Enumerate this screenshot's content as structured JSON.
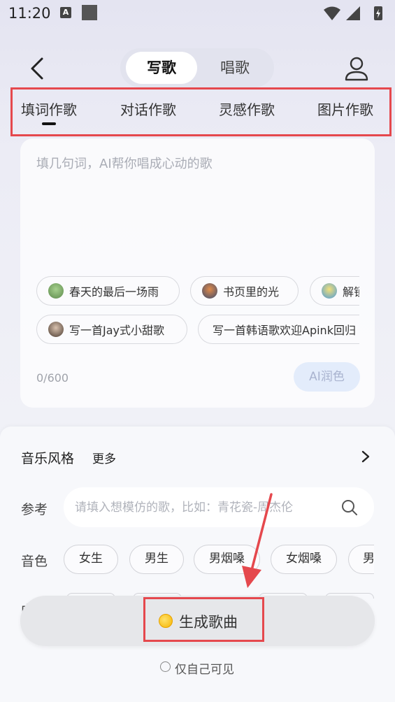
{
  "status_bar": {
    "time": "11:20",
    "app_icon_letter": "A"
  },
  "header": {
    "tabs": [
      {
        "label": "写歌",
        "active": true
      },
      {
        "label": "唱歌",
        "active": false
      }
    ]
  },
  "mode_tabs": [
    {
      "label": "填词作歌",
      "active": true
    },
    {
      "label": "对话作歌",
      "active": false
    },
    {
      "label": "灵感作歌",
      "active": false
    },
    {
      "label": "图片作歌",
      "active": false
    }
  ],
  "lyrics": {
    "placeholder": "填几句词，AI帮你唱成心动的歌",
    "suggestions": [
      {
        "label": "春天的最后一场雨",
        "thumb_color": "#6ca06a"
      },
      {
        "label": "书页里的光",
        "thumb_color": "#b56b3d"
      },
      {
        "label": "解锁",
        "thumb_color": "#d8c35a"
      },
      {
        "label": "写一首Jay式小甜歌",
        "thumb_color": "#7a6a5d"
      },
      {
        "label": "写一首韩语歌欢迎Apink回归",
        "thumb_color": ""
      }
    ],
    "counter": "0/600",
    "ai_polish_label": "AI润色"
  },
  "music_style": {
    "label": "音乐风格",
    "more_label": "更多"
  },
  "reference": {
    "label": "参考",
    "placeholder": "请填入想模仿的歌，比如：青花瓷-周杰伦"
  },
  "voice": {
    "label": "音色",
    "options": [
      "女生",
      "男生",
      "男烟嗓",
      "女烟嗓",
      "男"
    ]
  },
  "hidden_row_label": "中",
  "generate": {
    "label": "生成歌曲"
  },
  "privacy": {
    "label": "仅自己可见"
  },
  "colors": {
    "highlight": "#e5484d",
    "accent_bg": "#e3ecfb"
  }
}
